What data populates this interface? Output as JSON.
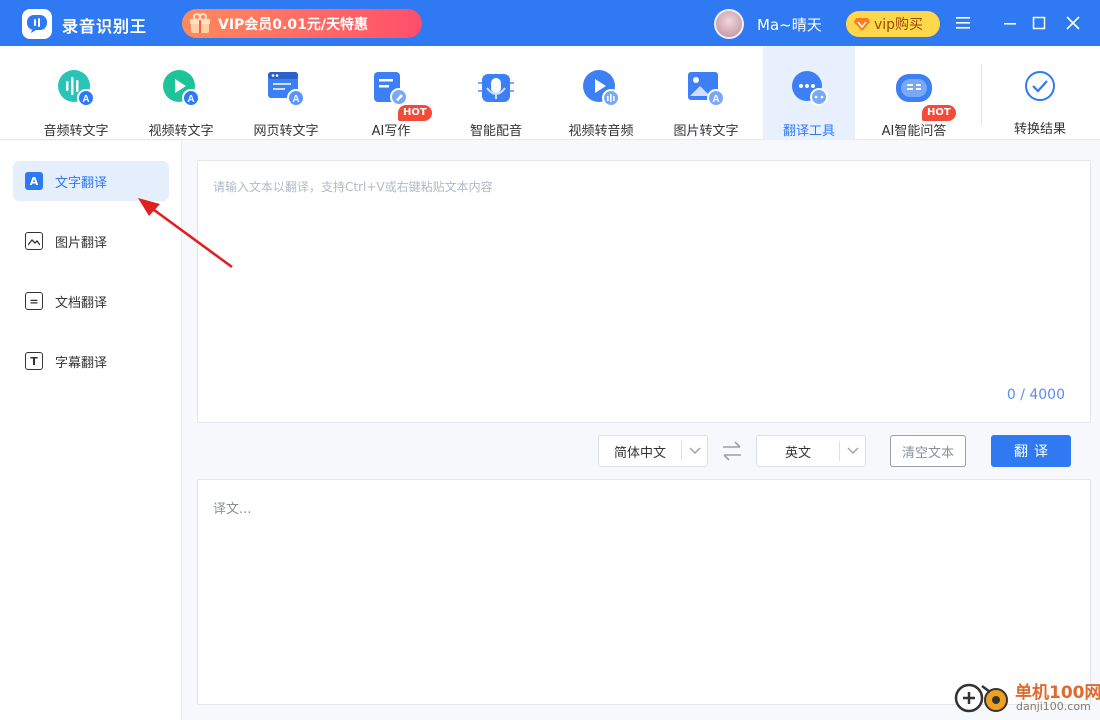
{
  "app": {
    "title": "录音识别王"
  },
  "promo": {
    "text": "VIP会员0.01元/天特惠"
  },
  "user": {
    "name": "Ma~晴天"
  },
  "vip_button": {
    "label": "vip购买"
  },
  "toolbar": {
    "items": [
      {
        "label": "音频转文字",
        "icon": "audio-to-text-icon"
      },
      {
        "label": "视频转文字",
        "icon": "video-to-text-icon"
      },
      {
        "label": "网页转文字",
        "icon": "webpage-to-text-icon"
      },
      {
        "label": "AI写作",
        "icon": "ai-writing-icon",
        "badge": "HOT"
      },
      {
        "label": "智能配音",
        "icon": "smart-dubbing-icon"
      },
      {
        "label": "视频转音频",
        "icon": "video-to-audio-icon"
      },
      {
        "label": "图片转文字",
        "icon": "image-to-text-icon"
      },
      {
        "label": "翻译工具",
        "icon": "translate-tool-icon",
        "active": true
      },
      {
        "label": "AI智能问答",
        "icon": "ai-qa-icon",
        "badge": "HOT"
      }
    ],
    "result": {
      "label": "转换结果",
      "icon": "check-circle-icon"
    }
  },
  "sidebar": {
    "items": [
      {
        "label": "文字翻译",
        "glyph": "A",
        "active": true
      },
      {
        "label": "图片翻译",
        "glyph": ""
      },
      {
        "label": "文档翻译",
        "glyph": "="
      },
      {
        "label": "字幕翻译",
        "glyph": "T"
      }
    ]
  },
  "input": {
    "placeholder": "请输入文本以翻译，支持Ctrl+V或右键粘贴文本内容",
    "counter": "0 / 4000"
  },
  "controls": {
    "source_lang": "简体中文",
    "target_lang": "英文",
    "clear_label": "清空文本",
    "translate_label": "翻译"
  },
  "output": {
    "placeholder": "译文..."
  },
  "watermark": {
    "title": "单机100网",
    "url": "danji100.com"
  },
  "colors": {
    "primary": "#2f79f3",
    "hot": "#f24b3a",
    "vip": "#ffd74a",
    "arrow": "#e02020"
  }
}
